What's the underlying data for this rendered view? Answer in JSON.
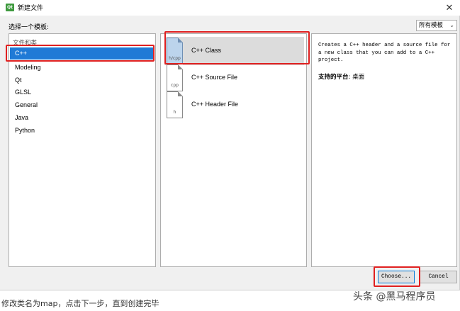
{
  "window": {
    "icon_text": "Qt",
    "title": "新建文件",
    "close_glyph": "✕"
  },
  "template_label": "选择一个模板:",
  "filter": {
    "selected": "所有模板",
    "chevron": "⌄"
  },
  "categories": {
    "header": "文件和类",
    "items": [
      "C++",
      "Modeling",
      "Qt",
      "GLSL",
      "General",
      "Java",
      "Python"
    ],
    "selected_index": 0
  },
  "templates": [
    {
      "name": "C++ Class",
      "icon_ext": "h/cpp",
      "icon": "cpp-class-file-icon",
      "selected": true
    },
    {
      "name": "C++ Source File",
      "icon_ext": "cpp",
      "icon": "cpp-source-file-icon",
      "selected": false
    },
    {
      "name": "C++ Header File",
      "icon_ext": "h",
      "icon": "cpp-header-file-icon",
      "selected": false
    }
  ],
  "description": {
    "text": "Creates a C++ header and a source file for a new class that you can add to a C++ project.",
    "platform_label": "支持的平台",
    "platform_value": ": 桌面"
  },
  "buttons": {
    "choose": "Choose...",
    "cancel": "Cancel"
  },
  "caption": "修改类名为map，点击下一步，直到创建完毕",
  "watermark": "头条 @黑马程序员",
  "colors": {
    "selection": "#1f7ad6",
    "highlight_box": "#e02020"
  }
}
